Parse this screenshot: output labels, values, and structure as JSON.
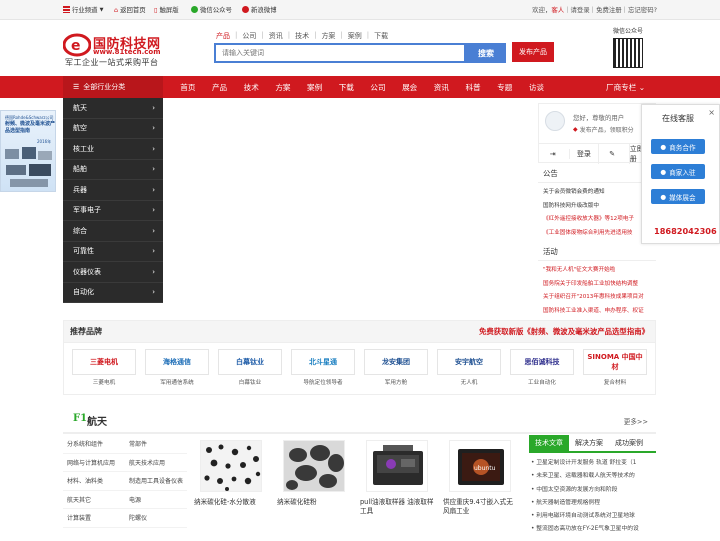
{
  "topbar": {
    "links": [
      "行业频道",
      "返回首页",
      "触屏版",
      "微信公众号",
      "新浪微博"
    ],
    "welcome": "欢迎，",
    "guest": "客人",
    "right_links": "｜请登录｜免费注册｜忘记密码?"
  },
  "header": {
    "site_name": "国防科技网",
    "site_url": "www.81tech.com",
    "slogan": "军工企业一站式采购平台",
    "search_tabs": [
      "产品",
      "公司",
      "资讯",
      "技术",
      "方案",
      "案例",
      "下载"
    ],
    "search_placeholder": "请输入关键词",
    "search_button": "搜索",
    "publish_button": "发布产品",
    "qr_label": "微信公众号"
  },
  "nav": {
    "all_categories": "全部行业分类",
    "items": [
      "首页",
      "产品",
      "技术",
      "方案",
      "案例",
      "下载",
      "公司",
      "展会",
      "资讯",
      "科普",
      "专题",
      "访谈"
    ],
    "special": "厂商专栏"
  },
  "categories": [
    "航天",
    "航空",
    "核工业",
    "船舶",
    "兵器",
    "军事电子",
    "综合",
    "可靠性",
    "仪器仪表",
    "自动化"
  ],
  "ad": {
    "line1": "德国Rohde&Schwarz公司",
    "line2": "射频、微波及毫米波产品选型指南",
    "line3": "2016年"
  },
  "user_card": {
    "greeting": "您好，尊敬的用户",
    "subtitle": "发布产品，领取积分",
    "login": "登录",
    "register": "立即注册"
  },
  "notice": {
    "title": "公告",
    "items": [
      {
        "text": "关于会员微销会费的通知",
        "red": false
      },
      {
        "text": "国防科技网升级改版中",
        "red": false
      },
      {
        "text": "《红外遥控接收放大器》等12项电子",
        "red": true
      },
      {
        "text": "《工业固体废物综合利用先进适用技",
        "red": true
      }
    ],
    "activity_title": "活动",
    "activities": [
      "\"我和无人机\"征文大赛开始啦",
      "国务院关于印发船舶工业加快结构调整",
      "关于组织召开\"2013年惠科技成果项目对",
      "国防科技工业准入渠道、申办程序、权证"
    ]
  },
  "service": {
    "title": "在线客服",
    "close": "×",
    "buttons": [
      "商务合作",
      "商家入驻",
      "媒体展会"
    ],
    "phone": "18682042306"
  },
  "brands": {
    "title": "推荐品牌",
    "promo": "免费获取新版《射频、微波及毫米波产品选型指南》",
    "items": [
      {
        "logo": "三菱电机",
        "name": "三菱电机",
        "color": "#d0191f"
      },
      {
        "logo": "海格通信",
        "name": "军用通信系统",
        "color": "#1f6fb8"
      },
      {
        "logo": "白幕钛业",
        "name": "白幕钛业",
        "color": "#1f5da8"
      },
      {
        "logo": "北斗星通",
        "name": "导航定位领导者",
        "color": "#1a7fc1"
      },
      {
        "logo": "龙安集团",
        "name": "军用方舱",
        "color": "#1d4f91"
      },
      {
        "logo": "安宇航空",
        "name": "无人机",
        "color": "#1d4f91"
      },
      {
        "logo": "思佰诚科技",
        "name": "工业自动化",
        "color": "#2a2a8a"
      },
      {
        "logo": "SINOMA 中国中材",
        "name": "复合材料",
        "color": "#d0191f"
      }
    ]
  },
  "section_f1": {
    "index": "F1",
    "name": "航天",
    "more": "更多>>",
    "subcategories": [
      [
        "分系统和组件",
        "常部件"
      ],
      [
        "网络与计算机应用",
        "航天技术应用"
      ],
      [
        "材料、油料类",
        "制造用工具设备仪表"
      ],
      [
        "航天其它",
        "电源"
      ],
      [
        "计算装置",
        "陀螺仪"
      ]
    ],
    "products": [
      "纳米碳化硅-水分散液",
      "纳米碳化硅粉",
      "pull油液取样器 油液取样工具",
      "供应重庆9.4寸嵌入式无风扇工业"
    ],
    "news_tabs": [
      "技术文章",
      "解决方案",
      "成功案例"
    ],
    "news": [
      "卫星定制设计开发服务 轨道 舒拉变（1",
      "未来卫星、运载器和载人航天等技术的",
      "中国太空资源的发展方向和阶段",
      "航天器制造管理规格例程",
      "利用电磁环境自动测试系统对卫星地球",
      "整流固态高功放在FY-2E气象卫星中的设"
    ]
  }
}
